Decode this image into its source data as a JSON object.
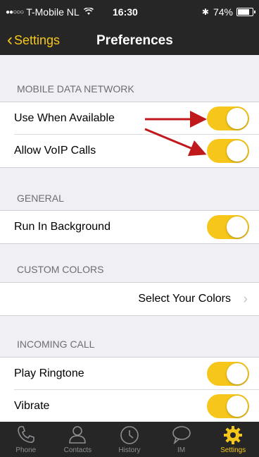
{
  "status": {
    "carrier": "T-Mobile NL",
    "time": "16:30",
    "battery": "74%",
    "signal_dots": "●●○○○"
  },
  "nav": {
    "back_label": "Settings",
    "title": "Preferences"
  },
  "sections": {
    "mobile_data": {
      "header": "MOBILE DATA NETWORK",
      "rows": [
        {
          "label": "Use When Available",
          "on": true
        },
        {
          "label": "Allow VoIP Calls",
          "on": true
        }
      ]
    },
    "general": {
      "header": "GENERAL",
      "rows": [
        {
          "label": "Run In Background",
          "on": true
        }
      ]
    },
    "custom_colors": {
      "header": "CUSTOM COLORS",
      "link_label": "Select Your Colors"
    },
    "incoming_call": {
      "header": "INCOMING CALL",
      "rows": [
        {
          "label": "Play Ringtone",
          "on": true
        },
        {
          "label": "Vibrate",
          "on": true
        }
      ]
    }
  },
  "tabs": [
    {
      "label": "Phone",
      "icon": "phone-icon"
    },
    {
      "label": "Contacts",
      "icon": "contacts-icon"
    },
    {
      "label": "History",
      "icon": "history-icon"
    },
    {
      "label": "IM",
      "icon": "chat-icon"
    },
    {
      "label": "Settings",
      "icon": "gear-icon",
      "active": true
    }
  ],
  "colors": {
    "accent": "#f6c71a",
    "bar": "#262626",
    "arrow": "#c0191c"
  }
}
